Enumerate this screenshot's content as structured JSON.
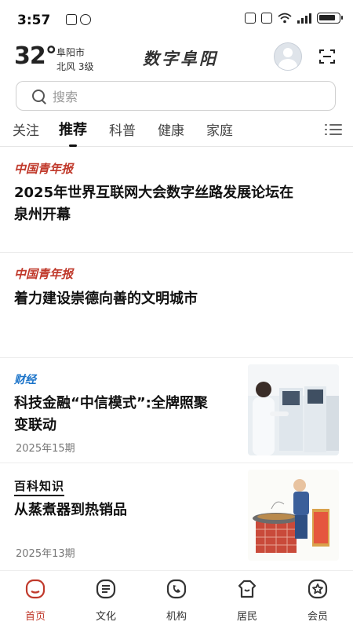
{
  "status": {
    "time": "3:57"
  },
  "header": {
    "temperature": "32°",
    "city": "阜阳市",
    "wind": "北风  3级",
    "logo_text": "数字阜阳"
  },
  "search": {
    "placeholder": "搜索"
  },
  "tabs": [
    {
      "label": "关注"
    },
    {
      "label": "推荐",
      "active": true
    },
    {
      "label": "科普"
    },
    {
      "label": "健康"
    },
    {
      "label": "家庭"
    }
  ],
  "articles": [
    {
      "source": "中国青年报",
      "title_line1": "2025年世界互联网大会数字丝路发展论坛在",
      "title_line2": "泉州开幕"
    },
    {
      "source": "中国青年报",
      "title_line1": "着力建设崇德向善的文明城市"
    },
    {
      "source": "财经",
      "title_line1": "科技金融“中信模式”:全牌照聚",
      "title_line2": "变联动",
      "date": "2025年15期",
      "image": "lab-technician-photo"
    },
    {
      "source": "百科知识",
      "title_line1": "从蒸煮器到热销品",
      "date": "2025年13期",
      "image": "cooking-illustration"
    }
  ],
  "bottom_nav": [
    {
      "label": "首页",
      "icon": "home-icon",
      "active": true
    },
    {
      "label": "文化",
      "icon": "culture-icon"
    },
    {
      "label": "机构",
      "icon": "institution-icon"
    },
    {
      "label": "居民",
      "icon": "resident-icon"
    },
    {
      "label": "会员",
      "icon": "member-icon"
    }
  ],
  "colors": {
    "accent": "#c0392b",
    "caijing_blue": "#1a73c9"
  }
}
